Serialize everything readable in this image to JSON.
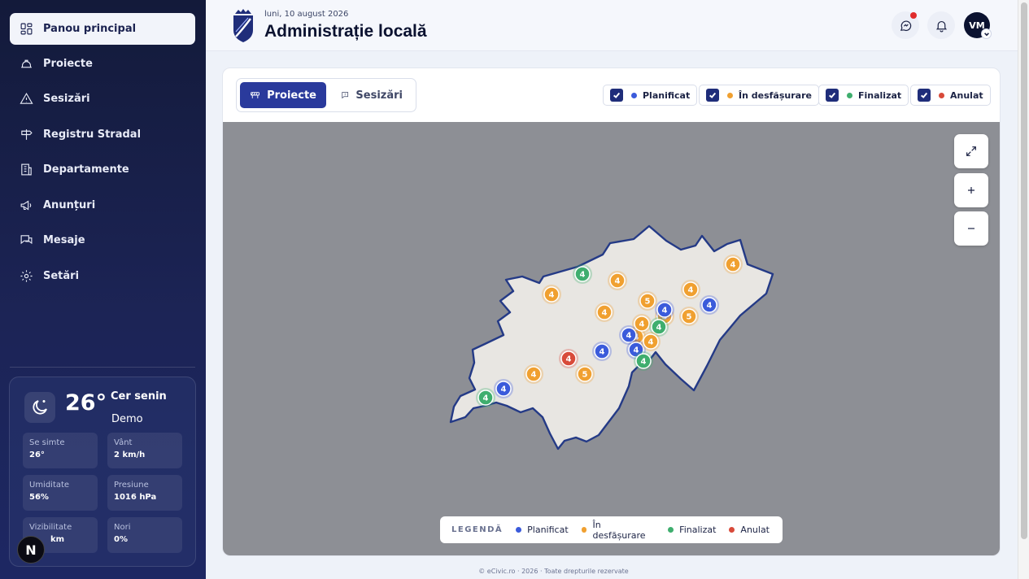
{
  "sidebar": {
    "items": [
      {
        "label": "Panou principal",
        "icon": "dashboard-icon"
      },
      {
        "label": "Proiecte",
        "icon": "hardhat-icon"
      },
      {
        "label": "Sesizări",
        "icon": "warning-icon"
      },
      {
        "label": "Registru Stradal",
        "icon": "signpost-icon"
      },
      {
        "label": "Departamente",
        "icon": "building-icon"
      },
      {
        "label": "Anunțuri",
        "icon": "megaphone-icon"
      },
      {
        "label": "Mesaje",
        "icon": "messages-icon"
      },
      {
        "label": "Setări",
        "icon": "gear-icon"
      }
    ]
  },
  "weather": {
    "temp": "26°",
    "condition": "Cer senin",
    "demo": "Demo",
    "cells": [
      {
        "label": "Se simte",
        "value": "26°"
      },
      {
        "label": "Vânt",
        "value": "2 km/h"
      },
      {
        "label": "Umiditate",
        "value": "56%"
      },
      {
        "label": "Presiune",
        "value": "1016 hPa"
      },
      {
        "label": "Vizibilitate",
        "value": "km"
      },
      {
        "label": "Nori",
        "value": "0%"
      }
    ],
    "badge": "N"
  },
  "header": {
    "date": "luni, 10 august 2026",
    "title": "Administrație locală",
    "avatar_initials": "VM"
  },
  "tabs": {
    "projects": "Proiecte",
    "reports": "Sesizări"
  },
  "filters": [
    {
      "label": "Planificat",
      "color": "#3b5bdb"
    },
    {
      "label": "În desfășurare",
      "color": "#f0a030"
    },
    {
      "label": "Finalizat",
      "color": "#3fae6e"
    },
    {
      "label": "Anulat",
      "color": "#d84a3a"
    }
  ],
  "legend": {
    "title": "LEGENDĂ",
    "items": [
      {
        "label": "Planificat",
        "color": "#3b5bdb"
      },
      {
        "label": "În desfășurare",
        "color": "#f0a030"
      },
      {
        "label": "Finalizat",
        "color": "#3fae6e"
      },
      {
        "label": "Anulat",
        "color": "#d84a3a"
      }
    ]
  },
  "markers": [
    {
      "n": "4",
      "status": 2
    },
    {
      "n": "4",
      "status": 0
    },
    {
      "n": "4",
      "status": 1
    },
    {
      "n": "4",
      "status": 1
    },
    {
      "n": "4",
      "status": 2
    },
    {
      "n": "4",
      "status": 1
    },
    {
      "n": "4",
      "status": 1
    },
    {
      "n": "5",
      "status": 1
    },
    {
      "n": "5",
      "status": 1
    },
    {
      "n": "4",
      "status": 0
    },
    {
      "n": "4",
      "status": 3
    },
    {
      "n": "5",
      "status": 1
    },
    {
      "n": "4",
      "status": 0
    },
    {
      "n": "4",
      "status": 1
    },
    {
      "n": "4",
      "status": 0
    },
    {
      "n": "4",
      "status": 1
    },
    {
      "n": "4",
      "status": 2
    },
    {
      "n": "4",
      "status": 0
    },
    {
      "n": "4",
      "status": 2
    },
    {
      "n": "4",
      "status": 1
    },
    {
      "n": "5",
      "status": 1
    },
    {
      "n": "4",
      "status": 1
    },
    {
      "n": "4",
      "status": 0
    },
    {
      "n": "4",
      "status": 1
    }
  ],
  "footer": "© eCivic.ro · 2026 · Toate drepturile rezervate"
}
